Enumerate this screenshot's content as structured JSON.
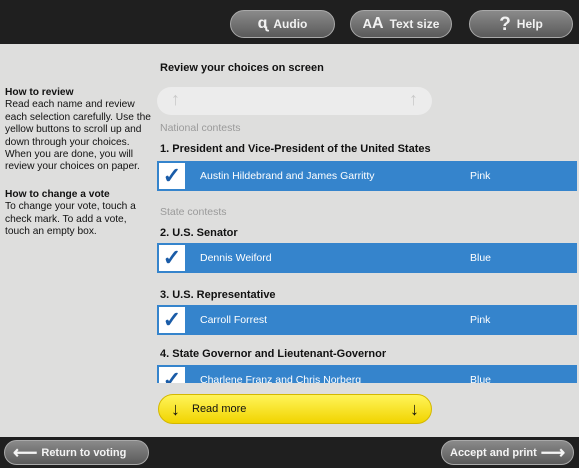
{
  "toolbar": {
    "audio_label": "Audio",
    "text_size_label": "Text size",
    "text_size_glyph": "AA",
    "help_label": "Help",
    "help_glyph": "?"
  },
  "instructions": {
    "review_heading": "How to review",
    "review_body": "Read each name and review each selection carefully. Use the yellow buttons to scroll up and down through your choices. When you are done, you will review your choices on paper.",
    "change_heading": "How to change a vote",
    "change_body": "To change your vote, touch a check mark. To add a vote, touch an empty box."
  },
  "review_title": "Review your choices on screen",
  "sections": {
    "national": "National contests",
    "state": "State contests"
  },
  "contests": [
    {
      "title": "1. President and Vice-President of the United States",
      "candidate": "Austin Hildebrand and James Garritty",
      "party": "Pink",
      "checked": true
    },
    {
      "title": "2. U.S. Senator",
      "candidate": "Dennis Weiford",
      "party": "Blue",
      "checked": true
    },
    {
      "title": "3. U.S. Representative",
      "candidate": "Carroll Forrest",
      "party": "Pink",
      "checked": true
    },
    {
      "title": "4. State Governor and Lieutenant-Governor",
      "candidate": "Charlene Franz and Chris Norberg",
      "party": "Blue",
      "checked": true
    }
  ],
  "read_more_label": "Read more",
  "nav": {
    "back_label": "Return to voting",
    "next_label": "Accept and print"
  },
  "colors": {
    "choice_bg": "#3584cc",
    "read_more": "#f5e02a",
    "bar": "#1f1f1f"
  }
}
